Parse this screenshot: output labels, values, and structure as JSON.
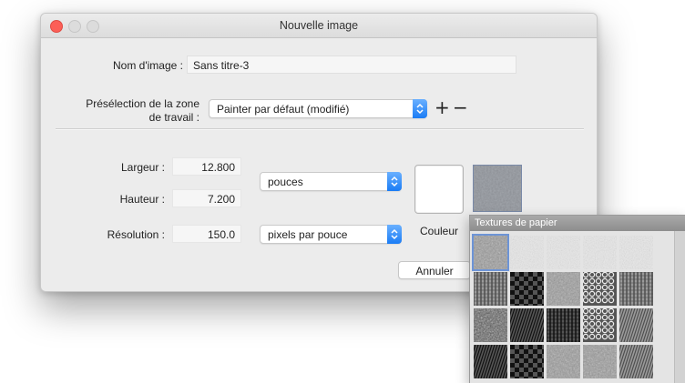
{
  "window": {
    "title": "Nouvelle image"
  },
  "form": {
    "name_label": "Nom d'image :",
    "name_value": "Sans titre-3",
    "preset_label_line1": "Présélection de la zone",
    "preset_label_line2": "de travail :",
    "preset_value": "Painter par défaut (modifié)",
    "add_symbol": "+",
    "remove_symbol": "−",
    "width_label": "Largeur :",
    "width_value": "12.800",
    "height_label": "Hauteur :",
    "height_value": "7.200",
    "units_value": "pouces",
    "resolution_label": "Résolution :",
    "resolution_value": "150.0",
    "resolution_units_value": "pixels par pouce",
    "color_label": "Couleur",
    "cancel_label": "Annuler"
  },
  "colors": {
    "accent": "#1a7cf5",
    "close": "#fc5f57",
    "selection": "#6d94d6"
  },
  "textures_panel": {
    "title": "Textures de papier",
    "selected_index": 0,
    "textures": [
      {
        "name": "grain-fine",
        "type": "noise",
        "tone": "mid"
      },
      {
        "name": "grain-light-1",
        "type": "noise",
        "tone": "light"
      },
      {
        "name": "grain-light-2",
        "type": "noise",
        "tone": "light"
      },
      {
        "name": "grain-light-3",
        "type": "noise",
        "tone": "light"
      },
      {
        "name": "grain-light-4",
        "type": "noise",
        "tone": "light"
      },
      {
        "name": "weave",
        "type": "weave",
        "tone": "mid"
      },
      {
        "name": "checker",
        "type": "checker",
        "tone": "dark"
      },
      {
        "name": "crackle",
        "type": "noise",
        "tone": "mid"
      },
      {
        "name": "dots-dark",
        "type": "dots",
        "tone": "dark"
      },
      {
        "name": "fabric",
        "type": "weave",
        "tone": "mid"
      },
      {
        "name": "stone-dark",
        "type": "noise",
        "tone": "dark"
      },
      {
        "name": "streak-dark",
        "type": "lines",
        "tone": "dark"
      },
      {
        "name": "grid-dark",
        "type": "weave",
        "tone": "dark"
      },
      {
        "name": "circles-dark",
        "type": "dots",
        "tone": "dark"
      },
      {
        "name": "hatch",
        "type": "lines",
        "tone": "mid"
      },
      {
        "name": "lines-dark",
        "type": "lines",
        "tone": "dark"
      },
      {
        "name": "bricks",
        "type": "checker",
        "tone": "dark"
      },
      {
        "name": "fiber",
        "type": "noise",
        "tone": "mid"
      },
      {
        "name": "crumple",
        "type": "noise",
        "tone": "mid"
      },
      {
        "name": "wave",
        "type": "lines",
        "tone": "mid"
      }
    ]
  }
}
